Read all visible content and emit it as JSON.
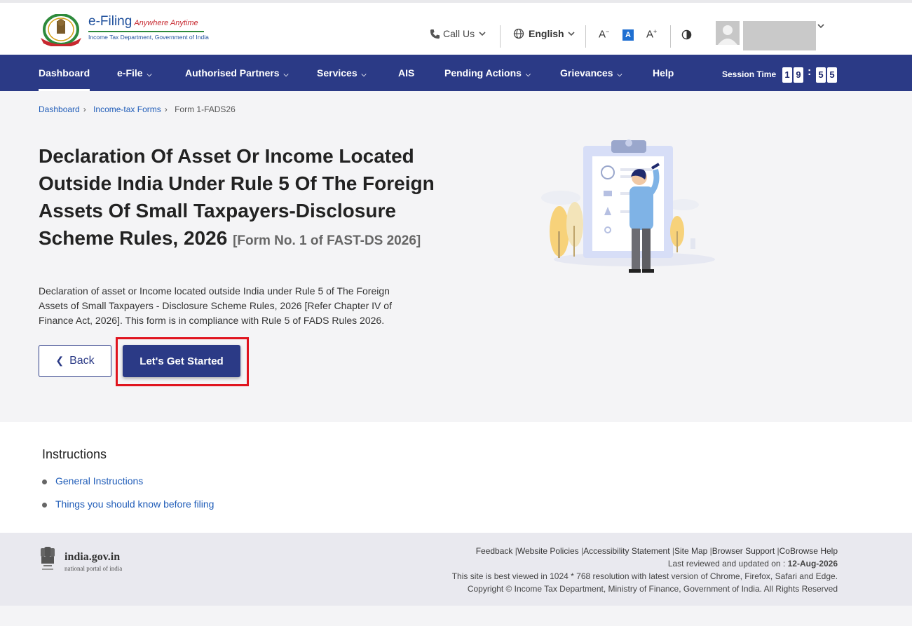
{
  "header": {
    "logo_title": "e-Filing",
    "logo_tagline": "Anywhere Anytime",
    "logo_subtitle": "Income Tax Department, Government of India",
    "call_us": "Call Us",
    "language": "English",
    "font_decrease": "A",
    "font_normal": "A",
    "font_increase": "A"
  },
  "nav": {
    "items": [
      {
        "label": "Dashboard"
      },
      {
        "label": "e-File"
      },
      {
        "label": "Authorised Partners"
      },
      {
        "label": "Services"
      },
      {
        "label": "AIS"
      },
      {
        "label": "Pending Actions"
      },
      {
        "label": "Grievances"
      },
      {
        "label": "Help"
      }
    ],
    "session_label": "Session Time",
    "session_digits": [
      "1",
      "9",
      "5",
      "5"
    ],
    "session_separator": ":"
  },
  "breadcrumb": {
    "items": [
      "Dashboard",
      "Income-tax Forms"
    ],
    "current": "Form 1-FADS26"
  },
  "main": {
    "title": "Declaration Of Asset Or Income Located Outside India Under Rule 5 Of The Foreign Assets Of Small Taxpayers-Disclosure Scheme Rules, 2026",
    "form_no": "[Form No. 1 of FAST-DS 2026]",
    "description": "Declaration of asset or Income located outside India under Rule 5 of The Foreign Assets of Small Taxpayers - Disclosure Scheme Rules, 2026 [Refer Chapter IV of Finance Act, 2026]. This form is in compliance with Rule 5 of FADS Rules 2026.",
    "back_label": "Back",
    "start_label": "Let's Get Started"
  },
  "instructions": {
    "heading": "Instructions",
    "items": [
      "General Instructions",
      "Things you should know before filing"
    ]
  },
  "footer": {
    "india_title": "india.gov.in",
    "india_subtitle": "national portal of india",
    "links": [
      "Feedback",
      "Website Policies",
      "Accessibility Statement",
      "Site Map",
      "Browser Support",
      "CoBrowse Help"
    ],
    "last_reviewed_label": "Last reviewed and updated on :",
    "last_reviewed_date": "12-Aug-2026",
    "best_viewed": "This site is best viewed in 1024 * 768 resolution with latest version of Chrome, Firefox, Safari and Edge.",
    "copyright": "Copyright © Income Tax Department, Ministry of Finance, Government of India. All Rights Reserved"
  },
  "colors": {
    "primary": "#2b3a86",
    "link": "#1f5cb8",
    "highlight": "#e0141e"
  }
}
